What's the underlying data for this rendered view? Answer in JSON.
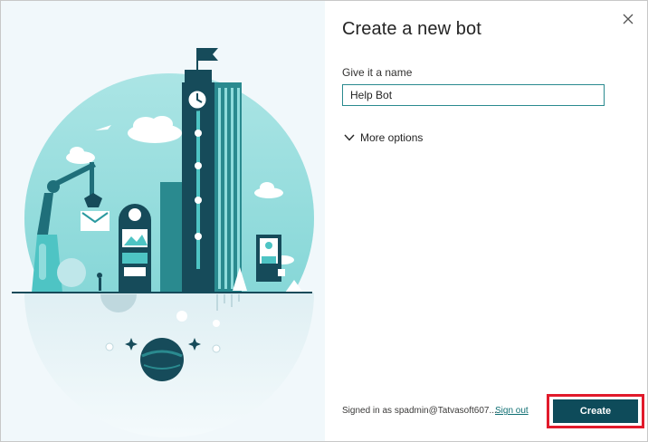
{
  "dialog": {
    "title": "Create a new bot",
    "name_label": "Give it a name",
    "name_value": "Help Bot",
    "more_options_label": "More options",
    "signed_in_text": "Signed in as spadmin@Tatvasoft607....",
    "sign_out_label": "Sign out",
    "create_label": "Create",
    "close_icon": "close-icon",
    "chevron_icon": "chevron-down-icon"
  },
  "colors": {
    "accent": "#0e4b5a",
    "link": "#0f6f73",
    "highlight_border": "#e11a2b",
    "illustration_teal": "#7fd4d6",
    "illustration_dark": "#164b5a"
  }
}
